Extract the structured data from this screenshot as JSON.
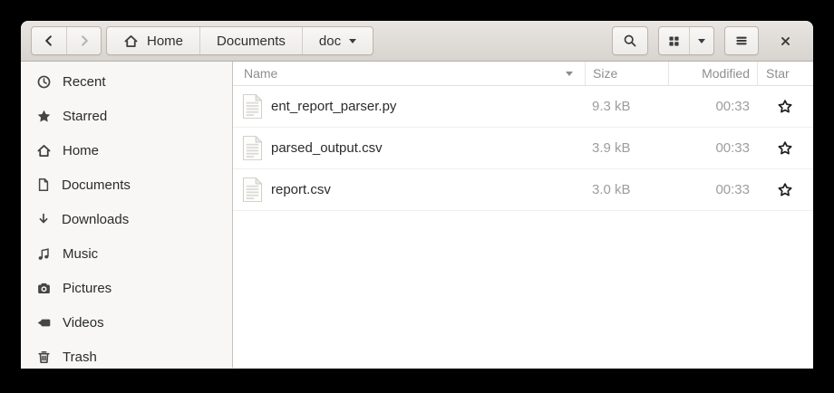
{
  "colors": {
    "desktop_bg": "#000000",
    "headerbar_top": "#e8e5e2",
    "headerbar_bottom": "#d8d4cf",
    "headerbar_border": "#b5aea6",
    "button_face": "#f4f2f0",
    "button_border": "#bcb5ad",
    "sidebar_bg": "#f8f7f6",
    "sidebar_border": "#c8c1ba",
    "list_bg": "#ffffff",
    "text_primary": "#2b2b2b",
    "text_secondary": "#9d9d9d",
    "column_header_text": "#8e8e8e",
    "row_divider": "#f0efed"
  },
  "header": {
    "back": {
      "icon": "back-icon"
    },
    "forward": {
      "icon": "forward-icon",
      "disabled": true
    },
    "breadcrumbs": [
      {
        "label": "Home",
        "icon": "home-icon"
      },
      {
        "label": "Documents"
      },
      {
        "label": "doc",
        "dropdown_icon": "chevron-down-icon"
      }
    ],
    "search": {
      "icon": "search-icon"
    },
    "view_toggle": {
      "icon": "grid-view-icon"
    },
    "view_options": {
      "icon": "chevron-down-icon"
    },
    "menu": {
      "icon": "hamburger-menu-icon"
    },
    "close": {
      "icon": "close-icon"
    }
  },
  "sidebar": {
    "items": [
      {
        "label": "Recent",
        "icon": "clock-icon"
      },
      {
        "label": "Starred",
        "icon": "star-filled-icon"
      },
      {
        "label": "Home",
        "icon": "home-icon"
      },
      {
        "label": "Documents",
        "icon": "document-icon"
      },
      {
        "label": "Downloads",
        "icon": "download-arrow-icon"
      },
      {
        "label": "Music",
        "icon": "music-notes-icon"
      },
      {
        "label": "Pictures",
        "icon": "camera-icon"
      },
      {
        "label": "Videos",
        "icon": "video-camera-icon"
      },
      {
        "label": "Trash",
        "icon": "trash-icon"
      }
    ]
  },
  "file_list": {
    "columns": [
      {
        "key": "name",
        "label": "Name",
        "sorted": true,
        "sort_icon": "sort-descending-icon"
      },
      {
        "key": "size",
        "label": "Size"
      },
      {
        "key": "modified",
        "label": "Modified"
      },
      {
        "key": "star",
        "label": "Star"
      }
    ],
    "rows": [
      {
        "icon": "text-file-icon",
        "name": "ent_report_parser.py",
        "size": "9.3 kB",
        "modified": "00:33",
        "star_icon": "star-outline-icon"
      },
      {
        "icon": "text-file-icon",
        "name": "parsed_output.csv",
        "size": "3.9 kB",
        "modified": "00:33",
        "star_icon": "star-outline-icon"
      },
      {
        "icon": "text-file-icon",
        "name": "report.csv",
        "size": "3.0 kB",
        "modified": "00:33",
        "star_icon": "star-outline-icon"
      }
    ]
  }
}
